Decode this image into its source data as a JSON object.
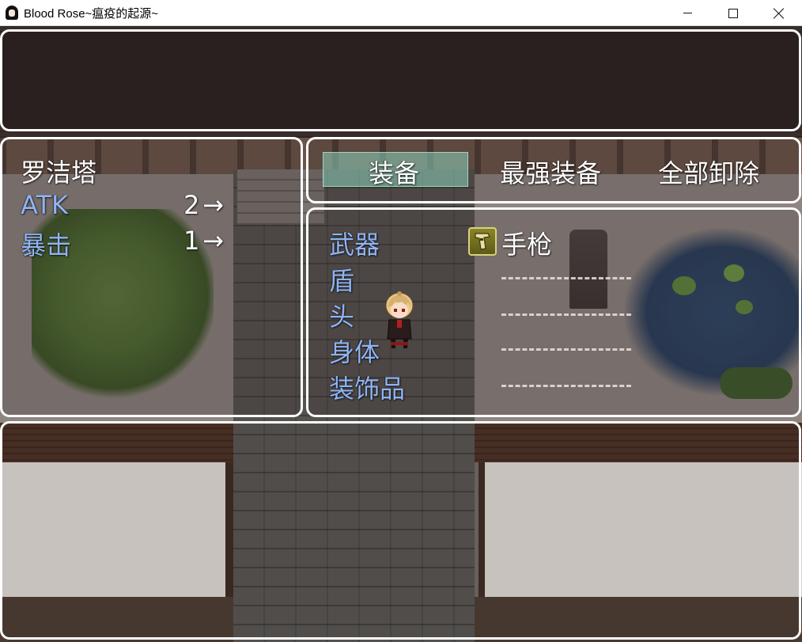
{
  "window": {
    "title": "Blood Rose~瘟疫的起源~",
    "controls": {
      "minimize": "minimize",
      "maximize": "maximize",
      "close": "close"
    }
  },
  "status": {
    "actor_name": "罗洁塔",
    "params": [
      {
        "label": "ATK",
        "value": "2",
        "arrow": "→"
      },
      {
        "label": "暴击",
        "value": "1",
        "arrow": "→"
      }
    ]
  },
  "commands": [
    {
      "label": "装备",
      "selected": true
    },
    {
      "label": "最强装备",
      "selected": false
    },
    {
      "label": "全部卸除",
      "selected": false
    }
  ],
  "slots": [
    {
      "label": "武器",
      "item": "手枪",
      "icon": "pistol-icon"
    },
    {
      "label": "盾",
      "item": "------------"
    },
    {
      "label": "头",
      "item": "------------"
    },
    {
      "label": "身体",
      "item": "------------"
    },
    {
      "label": "装饰品",
      "item": "------------"
    }
  ],
  "colors": {
    "system_blue": "#8fb4f4",
    "text_white": "#ffffff",
    "cursor": "#8cd2be"
  }
}
